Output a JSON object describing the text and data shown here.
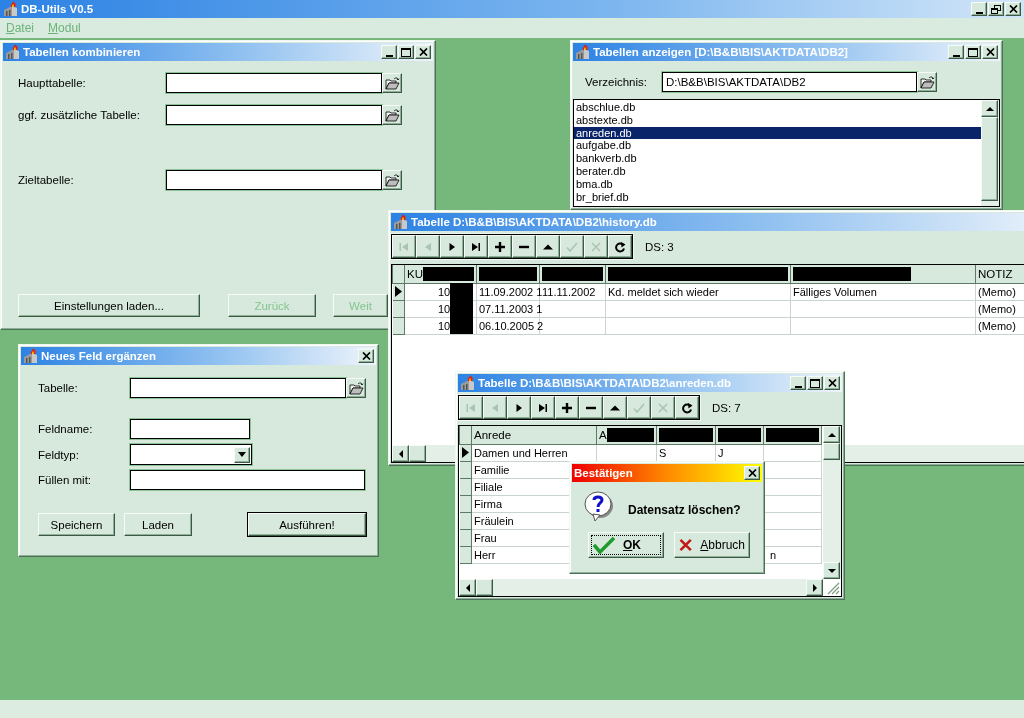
{
  "app": {
    "title": "DB-Utils V0.5",
    "menu": [
      {
        "label": "Datei"
      },
      {
        "label": "Modul"
      }
    ]
  },
  "combine_window": {
    "title": "Tabellen kombinieren",
    "fields": [
      {
        "label": "Haupttabelle:"
      },
      {
        "label": "ggf. zusätzliche Tabelle:"
      },
      {
        "label": "Zieltabelle:"
      }
    ],
    "buttons": [
      {
        "label": "Einstellungen laden...",
        "disabled": false
      },
      {
        "label": "Zurück",
        "disabled": true
      },
      {
        "label": "Weit",
        "disabled": true
      }
    ]
  },
  "list_window": {
    "title": "Tabellen anzeigen [D:\\B&B\\BIS\\AKTDATA\\DB2]",
    "directory_label": "Verzeichnis:",
    "directory": "D:\\B&B\\BIS\\AKTDATA\\DB2",
    "files": [
      {
        "name": "abschlue.db",
        "selected": false
      },
      {
        "name": "abstexte.db",
        "selected": false
      },
      {
        "name": "anreden.db",
        "selected": true
      },
      {
        "name": "aufgabe.db",
        "selected": false
      },
      {
        "name": "bankverb.db",
        "selected": false
      },
      {
        "name": "berater.db",
        "selected": false
      },
      {
        "name": "bma.db",
        "selected": false
      },
      {
        "name": "br_brief.db",
        "selected": false
      }
    ]
  },
  "history_window": {
    "title": "Tabelle D:\\B&B\\BIS\\AKTDATA\\DB2\\history.db",
    "toolbar": [
      {
        "kind": "first",
        "disabled": true
      },
      {
        "kind": "prior",
        "disabled": true
      },
      {
        "kind": "next",
        "disabled": false
      },
      {
        "kind": "last",
        "disabled": false
      },
      {
        "kind": "insert",
        "disabled": false
      },
      {
        "kind": "delete",
        "disabled": false
      },
      {
        "kind": "edit",
        "disabled": false
      },
      {
        "kind": "post",
        "disabled": true
      },
      {
        "kind": "cancel",
        "disabled": true
      },
      {
        "kind": "refresh",
        "disabled": false
      }
    ],
    "record_count": "DS: 3",
    "table": {
      "redacted": true,
      "columns": {
        "column_1": "KU",
        "column_6": "NOTIZ"
      },
      "rows": [
        {
          "selected": true,
          "cells": {
            "column_1": "10",
            "column_2": "11.09.2002 1",
            "column_3": "11.11.2002",
            "column_4": "Kd. meldet sich wieder",
            "column_5": "Fälliges Volumen",
            "column_6": "(Memo)"
          }
        },
        {
          "selected": false,
          "cells": {
            "column_1": "10",
            "column_2": "07.11.2003 1",
            "column_6": "(Memo)"
          }
        },
        {
          "selected": false,
          "cells": {
            "column_1": "10",
            "column_2": "06.10.2005 2",
            "column_6": "(Memo)"
          }
        }
      ]
    }
  },
  "fields_window": {
    "title": "Neues Feld ergänzen",
    "fields": [
      {
        "kind": "file",
        "label": "Tabelle:"
      },
      {
        "kind": "short",
        "label": "Feldname:"
      },
      {
        "kind": "dropdown",
        "label": "Feldtyp:"
      },
      {
        "kind": "long",
        "label": "Füllen mit:"
      }
    ],
    "buttons": [
      {
        "label": "Speichern",
        "default": false
      },
      {
        "label": "Laden",
        "default": false
      },
      {
        "label": "Ausführen!",
        "default": true
      }
    ]
  },
  "anreden_window": {
    "title": "Tabelle D:\\B&B\\BIS\\AKTDATA\\DB2\\anreden.db",
    "toolbar": [
      {
        "kind": "first",
        "disabled": true
      },
      {
        "kind": "prior",
        "disabled": true
      },
      {
        "kind": "next",
        "disabled": false
      },
      {
        "kind": "last",
        "disabled": false
      },
      {
        "kind": "insert",
        "disabled": false
      },
      {
        "kind": "delete",
        "disabled": false
      },
      {
        "kind": "edit",
        "disabled": false
      },
      {
        "kind": "post",
        "disabled": true
      },
      {
        "kind": "cancel",
        "disabled": true
      },
      {
        "kind": "refresh",
        "disabled": false
      }
    ],
    "record_count": "DS: 7",
    "table": {
      "redacted": true,
      "columns": {
        "column_1": "Anrede",
        "column_2": "A"
      },
      "rows": [
        {
          "selected": true,
          "cells": {
            "column_1": "Damen und Herren",
            "column_3": "S",
            "column_4": "J"
          }
        },
        {
          "selected": false,
          "cells": {
            "column_1": "Familie"
          }
        },
        {
          "selected": false,
          "cells": {
            "column_1": "Filiale"
          }
        },
        {
          "selected": false,
          "cells": {
            "column_1": "Firma"
          }
        },
        {
          "selected": false,
          "cells": {
            "column_1": "Fräulein"
          }
        },
        {
          "selected": false,
          "cells": {
            "column_1": "Frau"
          }
        },
        {
          "selected": false,
          "cells": {
            "column_1": "Herr",
            "column_5": "n"
          }
        }
      ]
    }
  },
  "dialog": {
    "title": "Bestätigen",
    "message": "Datensatz löschen?",
    "buttons": [
      {
        "kind": "ok",
        "label": "OK",
        "focused": true
      },
      {
        "kind": "cancel",
        "label": "Abbruch",
        "focused": false
      }
    ]
  }
}
